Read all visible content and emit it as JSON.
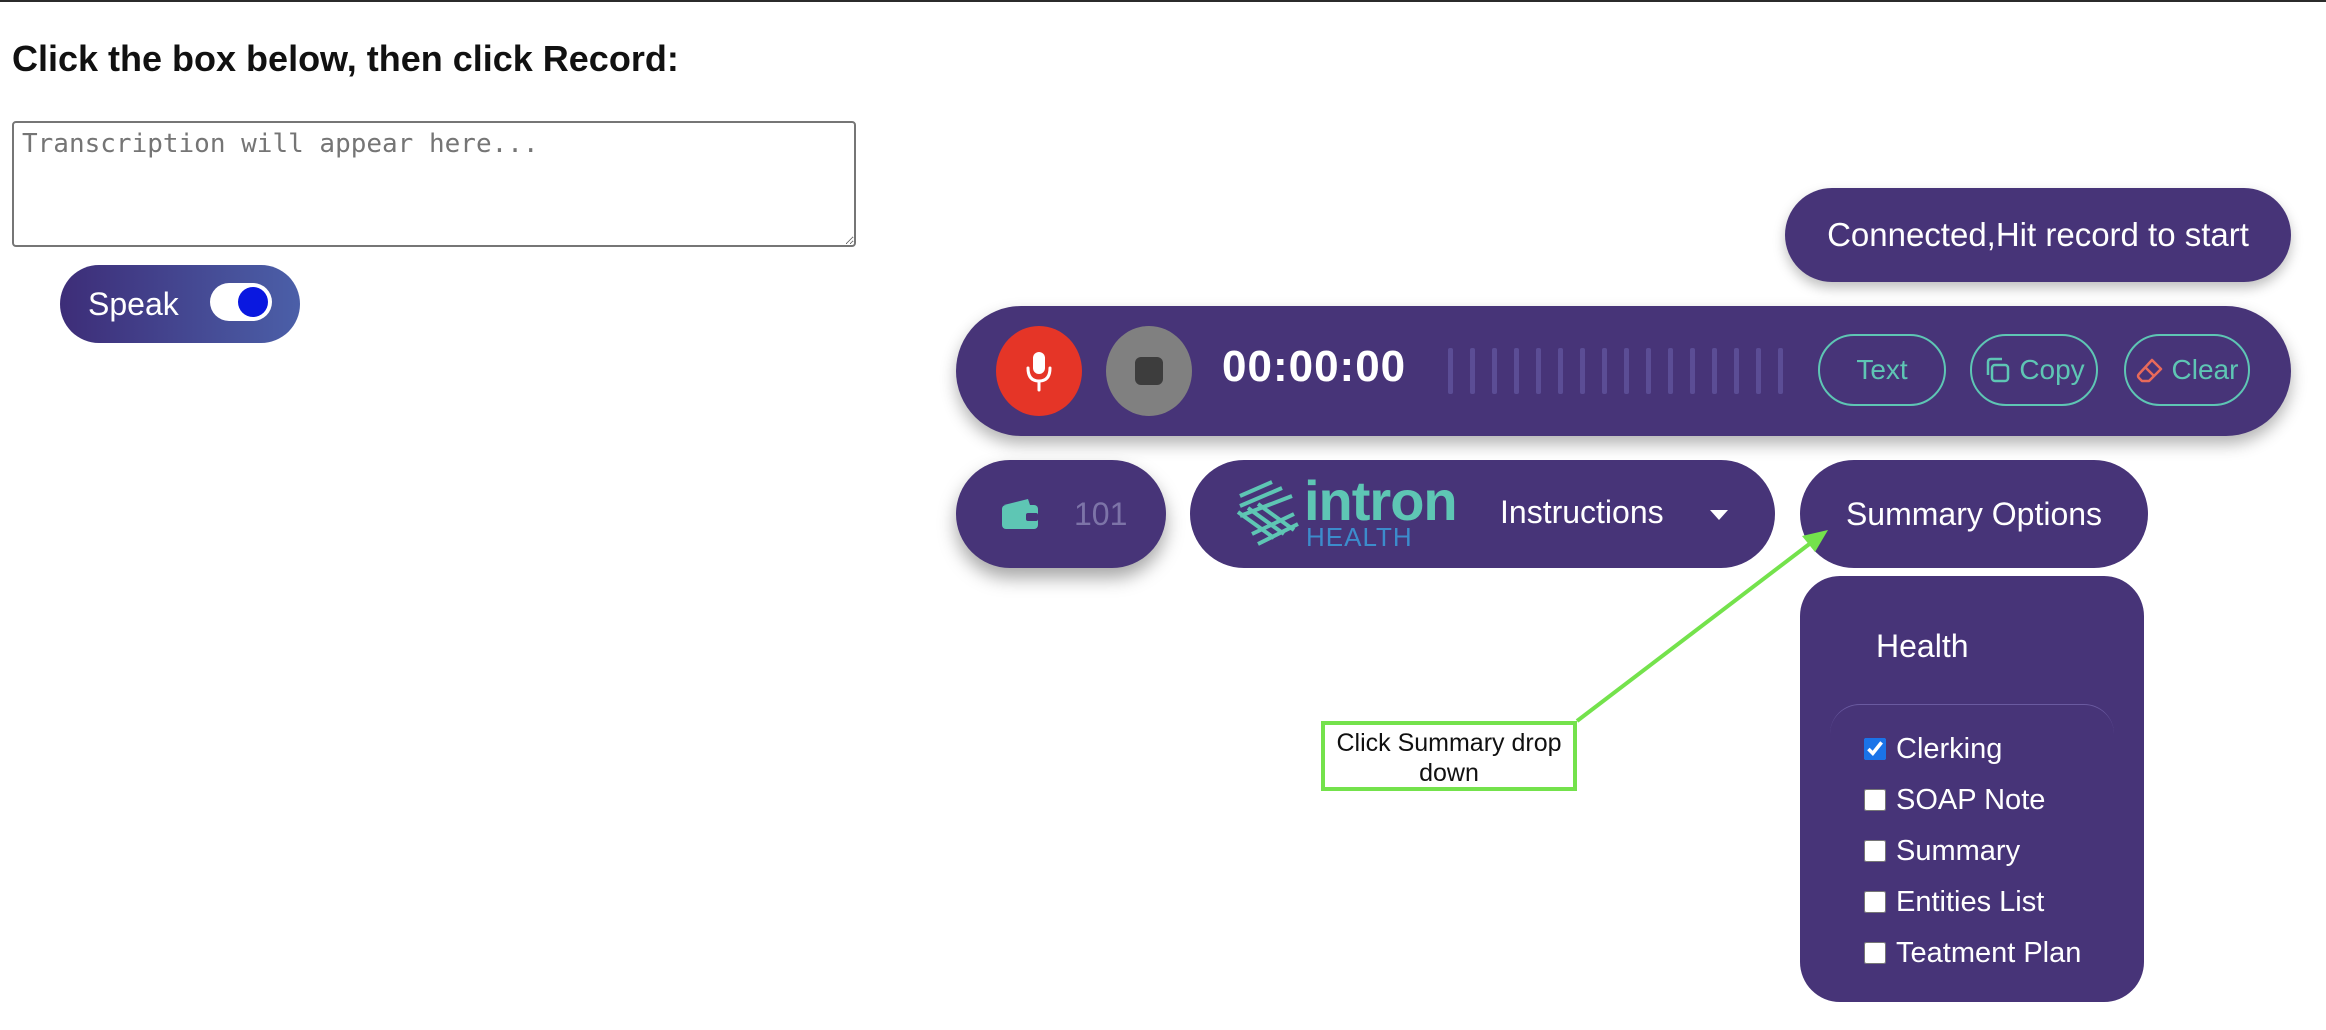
{
  "page": {
    "heading": "Click the box below, then click Record:"
  },
  "transcription": {
    "placeholder": "Transcription will appear here...",
    "value": ""
  },
  "speak_toggle": {
    "label": "Speak",
    "on": true
  },
  "status": {
    "text": "Connected,Hit record to start"
  },
  "recorder": {
    "timer": "00:00:00",
    "text_button": "Text",
    "copy_button": "Copy",
    "clear_button": "Clear"
  },
  "wallet": {
    "credit": "101"
  },
  "logo": {
    "word": "intron",
    "sub": "HEALTH"
  },
  "instructions": {
    "label": "Instructions"
  },
  "summary": {
    "button_label": "Summary Options",
    "group_header": "Health",
    "options": [
      {
        "label": "Clerking",
        "checked": true
      },
      {
        "label": "SOAP Note",
        "checked": false
      },
      {
        "label": "Summary",
        "checked": false
      },
      {
        "label": "Entities List",
        "checked": false
      },
      {
        "label": "Teatment Plan",
        "checked": false
      }
    ]
  },
  "annotation": {
    "text": "Click Summary drop down"
  },
  "colors": {
    "panel_purple": "#473478",
    "accent_teal": "#5ec6b4",
    "record_red": "#e53527",
    "stop_gray": "#808080",
    "clear_red": "#e86a5a",
    "annotation_green": "#74e24c",
    "toggle_knob_blue": "#0a18e0"
  },
  "icons": {
    "record": "microphone-icon",
    "stop": "stop-icon",
    "copy": "copy-icon",
    "clear": "eraser-icon",
    "wallet": "wallet-icon",
    "dropdown": "caret-down-icon"
  }
}
